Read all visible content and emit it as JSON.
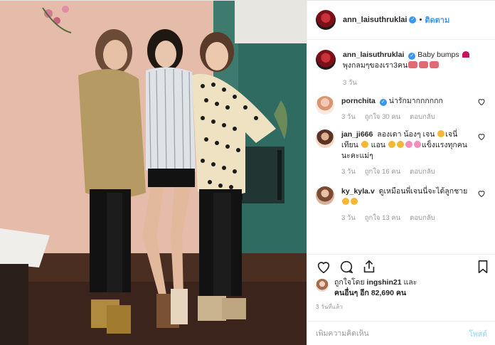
{
  "post": {
    "username": "ann_laisuthruklai",
    "follow_label": "ติดตาม",
    "separator": "•",
    "caption_user": "ann_laisuthruklai",
    "caption_text_1": " Baby bumps ",
    "caption_text_2": " พุงกลมๆของเรา3คน",
    "caption_time": "3 วัน"
  },
  "comments": [
    {
      "user": "pornchita",
      "text": "น่ารักมากกกกกก",
      "time": "3 วัน",
      "likes": "ถูกใจ 30 คน",
      "reply": "ตอบกลับ"
    },
    {
      "user": "jan_ji666",
      "text_1": " ลองเดา น้องๆ เจน ",
      "text_2": "เจนี่เทียน ",
      "text_3": " แอน ",
      "text_4": "แข็งแรงทุกคนนะคะแม่ๆ",
      "time": "3 วัน",
      "likes": "ถูกใจ 16 คน",
      "reply": "ตอบกลับ"
    },
    {
      "user": "ky_kyla.v",
      "text": " ดูเหมือนพี่เจนนี่จะได้ลูกชาย",
      "time": "3 วัน",
      "likes": "ถูกใจ 13 คน",
      "reply": "ตอบกลับ"
    }
  ],
  "likes": {
    "prefix": "ถูกใจโดย ",
    "user": "ingshin21",
    "and": " และ",
    "others": "คนอื่นๆ อีก 82,690 คน"
  },
  "time_ago": "3 วันที่แล้ว",
  "comment_box": {
    "placeholder": "เพิ่มความคิดเห็น",
    "post_label": "โพสต์"
  },
  "colors": {
    "link_blue": "#3897f0",
    "wall_pink": "#e3b8a6",
    "wall_teal": "#2f6b60",
    "heart_red": "#c2185b"
  }
}
